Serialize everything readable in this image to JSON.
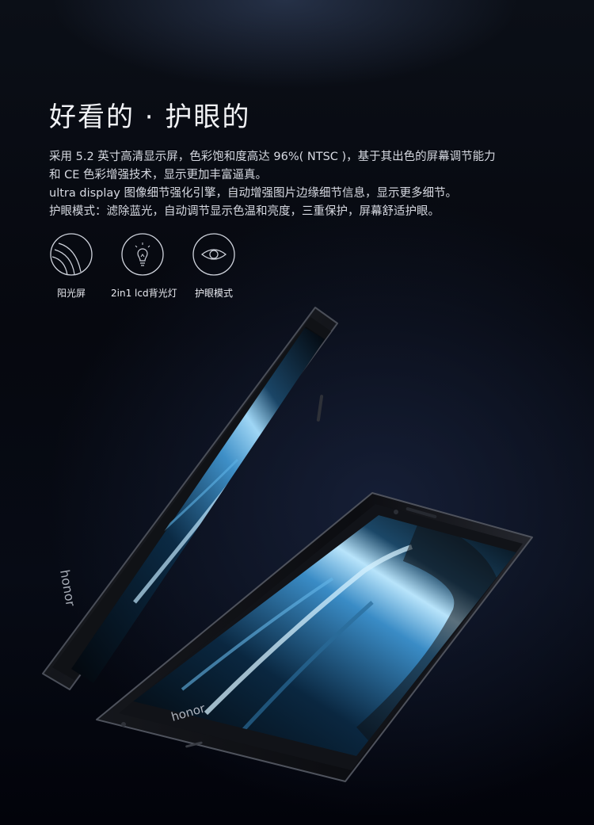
{
  "headline": "好看的 · 护眼的",
  "description": [
    "采用 5.2 英寸高清显示屏，色彩饱和度高达 96%( NTSC )，基于其出色的屏幕调节能力",
    "和 CE 色彩增强技术，显示更加丰富逼真。",
    "ultra display 图像细节强化引擎，自动增强图片边缘细节信息，显示更多细节。",
    "护眼模式：滤除蓝光，自动调节显示色温和亮度，三重保护，屏幕舒适护眼。"
  ],
  "features": [
    {
      "icon": "sunlight-screen-icon",
      "label": "阳光屏"
    },
    {
      "icon": "lightbulb-icon",
      "label": "2in1 lcd背光灯"
    },
    {
      "icon": "eye-icon",
      "label": "护眼模式"
    }
  ],
  "phones": {
    "brand": "honor"
  },
  "colors": {
    "background": "#05070d",
    "text": "#e6e8ee",
    "screen_highlight": "#4fa9e6",
    "phone_body": "#1a1c22"
  }
}
